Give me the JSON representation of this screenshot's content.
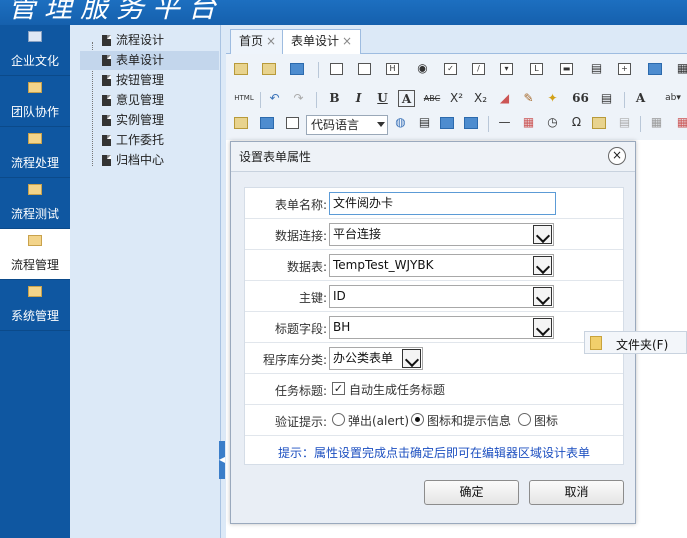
{
  "header": {
    "title": "管理服务平台"
  },
  "leftnav": {
    "items": [
      {
        "label": "企业文化",
        "icon": "id-card-icon"
      },
      {
        "label": "团队协作",
        "icon": "folder-icon"
      },
      {
        "label": "流程处理",
        "icon": "folder-icon"
      },
      {
        "label": "流程测试",
        "icon": "folder-icon"
      },
      {
        "label": "流程管理",
        "icon": "folder-icon",
        "active": true
      },
      {
        "label": "系统管理",
        "icon": "folder-icon"
      }
    ]
  },
  "tree": {
    "items": [
      {
        "label": "流程设计"
      },
      {
        "label": "表单设计",
        "selected": true
      },
      {
        "label": "按钮管理"
      },
      {
        "label": "意见管理"
      },
      {
        "label": "实例管理"
      },
      {
        "label": "工作委托"
      },
      {
        "label": "归档中心"
      }
    ]
  },
  "tabs": [
    {
      "label": "首页",
      "close": "×"
    },
    {
      "label": "表单设计",
      "close": "×",
      "active": true
    }
  ],
  "toolbar": {
    "html_label": "HTML",
    "bold": "B",
    "italic": "I",
    "underline": "U",
    "font_color": "A",
    "strike": "ABC",
    "sup": "X²",
    "sub": "X₂",
    "quote": "66",
    "omega": "Ω",
    "font_a": "A",
    "code_select": "代码语言"
  },
  "dialog": {
    "title": "设置表单属性",
    "close": "×",
    "fields": {
      "form_name": {
        "label": "表单名称:",
        "value": "文件阅办卡"
      },
      "data_conn": {
        "label": "数据连接:",
        "value": "平台连接"
      },
      "data_table": {
        "label": "数据表:",
        "value": "TempTest_WJYBK"
      },
      "primary_key": {
        "label": "主键:",
        "value": "ID"
      },
      "title_field": {
        "label": "标题字段:",
        "value": "BH"
      },
      "category": {
        "label": "程序库分类:",
        "value": "办公类表单"
      },
      "task_title": {
        "label": "任务标题:",
        "checkbox_label": "自动生成任务标题",
        "checked": true
      },
      "validation": {
        "label": "验证提示:",
        "options": [
          "弹出(alert)",
          "图标和提示信息",
          "图标"
        ],
        "selected": "图标和提示信息"
      }
    },
    "hint": "提示：属性设置完成点击确定后即可在编辑器区域设计表单",
    "ok_label": "确定",
    "cancel_label": "取消"
  },
  "folder_tip": {
    "label": "文件夹(F)"
  },
  "colors": {
    "nav_bg": "#0f57a1",
    "tree_bg": "#dce9f7",
    "hint": "#1c4fc0"
  }
}
